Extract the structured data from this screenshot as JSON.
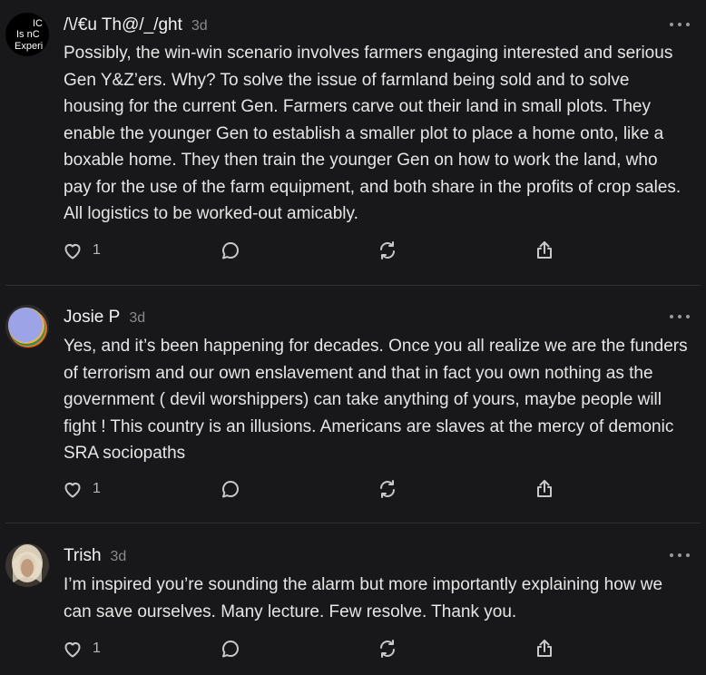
{
  "comments": [
    {
      "author": "/\\/€u Th@/_/ght",
      "time": "3d",
      "avatar_text": [
        "IC",
        "Is nC",
        "Experi"
      ],
      "text": "Possibly, the win-win scenario involves farmers engaging interested and serious Gen Y&Z’ers. Why? To solve the issue of farmland being sold and to solve housing for the current Gen. Farmers carve out their land in small plots. They enable the younger Gen to establish a smaller plot to place a home onto, like a boxable home. They then train the younger Gen on how to work the land, who pay for the use of the farm equipment, and both share in the profits of crop sales. All logistics to be worked-out amicably.",
      "likes": "1"
    },
    {
      "author": "Josie P",
      "time": "3d",
      "text": "Yes, and it’s been happening for decades. Once you all realize we are the funders of terrorism and our own enslavement and that in fact you own nothing as the government ( devil worshippers) can take anything of yours, maybe people will fight ! This country is an illusions. Americans are slaves at the mercy of demonic SRA sociopaths",
      "likes": "1"
    },
    {
      "author": "Trish",
      "time": "3d",
      "text": "I’m inspired you’re sounding the alarm but more importantly explaining how we can save ourselves. Many lecture. Few resolve. Thank you.",
      "likes": "1"
    }
  ],
  "icons": {
    "like": "heart-icon",
    "reply": "speech-bubble-icon",
    "restack": "restack-icon",
    "share": "share-icon",
    "more": "more-options-icon"
  },
  "colors": {
    "background": "#18181a",
    "text": "#e6e6e6",
    "muted": "#8a8a8e",
    "divider": "#2f2f33"
  }
}
